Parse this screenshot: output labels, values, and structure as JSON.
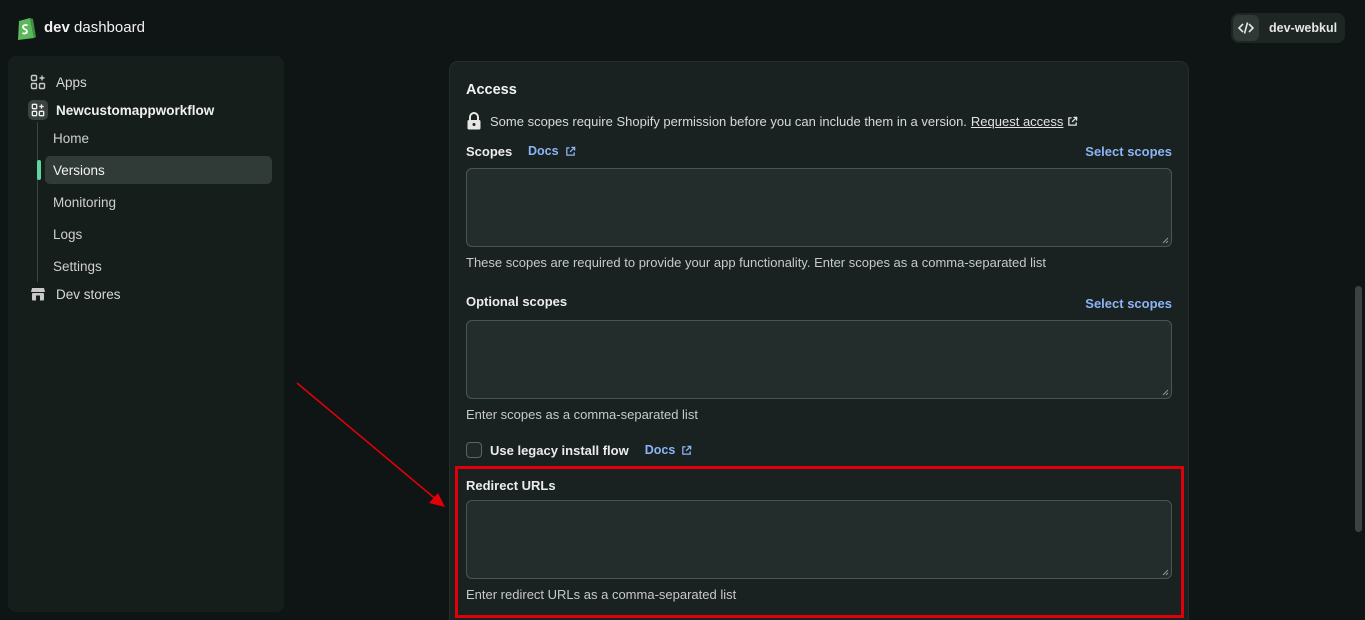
{
  "topbar": {
    "brand_bold": "dev",
    "brand_rest": "dashboard",
    "store_name": "dev-webkul"
  },
  "sidebar": {
    "apps_label": "Apps",
    "app_name": "Newcustomappworkflow",
    "sub_items": [
      "Home",
      "Versions",
      "Monitoring",
      "Logs",
      "Settings"
    ],
    "active_item": "Versions",
    "dev_stores_label": "Dev stores"
  },
  "access": {
    "title": "Access",
    "notice_text": "Some scopes require Shopify permission before you can include them in a version.",
    "request_access_label": "Request access",
    "scopes": {
      "label": "Scopes",
      "docs_label": "Docs",
      "select_label": "Select scopes",
      "value": "",
      "help": "These scopes are required to provide your app functionality. Enter scopes as a comma-separated list"
    },
    "optional_scopes": {
      "label": "Optional scopes",
      "select_label": "Select scopes",
      "value": "",
      "help": "Enter scopes as a comma-separated list"
    },
    "legacy_install": {
      "label": "Use legacy install flow",
      "docs_label": "Docs",
      "checked": false
    },
    "redirect_urls": {
      "label": "Redirect URLs",
      "value": "",
      "help": "Enter redirect URLs as a comma-separated list"
    }
  },
  "colors": {
    "accent_link": "#8cb4f5",
    "active_indicator": "#5fd6a0",
    "annotation_red": "#e0000a"
  }
}
